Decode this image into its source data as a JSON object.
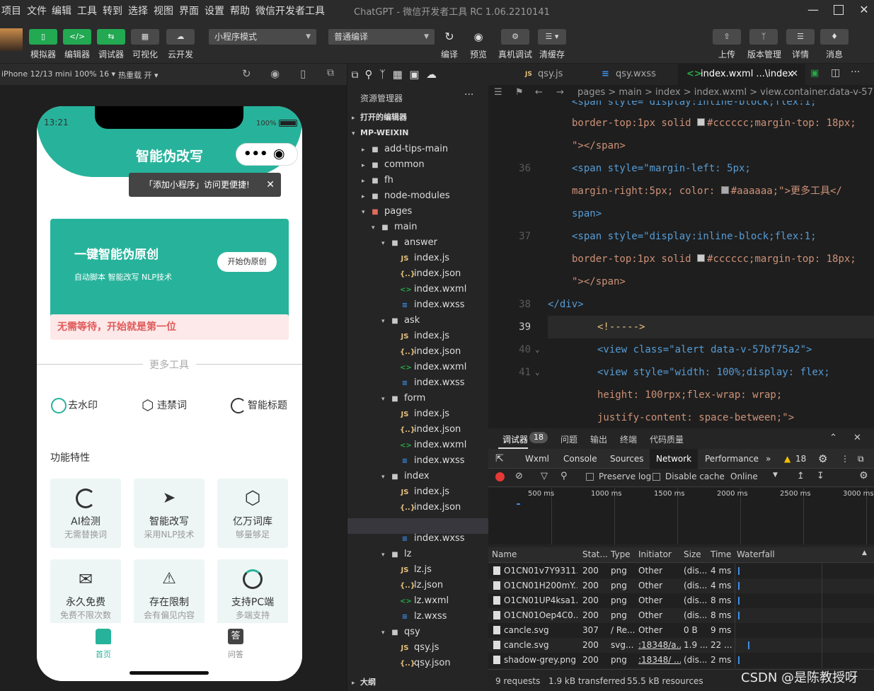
{
  "menubar": {
    "items": [
      "项目",
      "文件",
      "编辑",
      "工具",
      "转到",
      "选择",
      "视图",
      "界面",
      "设置",
      "帮助",
      "微信开发者工具"
    ],
    "window_title": "ChatGPT - 微信开发者工具 RC 1.06.2210141"
  },
  "toolbar": {
    "simulator": "模拟器",
    "editor": "编辑器",
    "debugger": "调试器",
    "visual": "可视化",
    "cloud": "云开发",
    "mode_select": "小程序模式",
    "compile_select": "普通编译",
    "compile": "编译",
    "preview": "预览",
    "real_debug": "真机调试",
    "clear_cache": "清缓存",
    "upload": "上传",
    "version": "版本管理",
    "details": "详情",
    "messages": "消息"
  },
  "devbar": {
    "device": "iPhone 12/13 mini 100% 16 ▾",
    "hotreload": "热重载 开 ▾"
  },
  "phone": {
    "time": "13:21",
    "battery": "100%",
    "title": "智能伪改写",
    "add_tip": "「添加小程序」访问更便捷!",
    "banner_title": "一键智能伪原创",
    "banner_sub": "自动脚本 智能改写 NLP技术",
    "banner_btn": "开始伪原创",
    "notice": "无需等待，开始就是第一位",
    "more_tools": "更多工具",
    "tools": [
      "去水印",
      "违禁词",
      "智能标题"
    ],
    "features_title": "功能特性",
    "features": [
      {
        "title": "AI检测",
        "sub": "无需替换词"
      },
      {
        "title": "智能改写",
        "sub": "采用NLP技术"
      },
      {
        "title": "亿万词库",
        "sub": "够量够足"
      },
      {
        "title": "永久免费",
        "sub": "免费不限次数"
      },
      {
        "title": "存在限制",
        "sub": "会有偏见内容"
      },
      {
        "title": "支持PC端",
        "sub": "多端支持"
      }
    ],
    "tab_home": "首页",
    "tab_qa": "问答"
  },
  "explorer": {
    "title": "资源管理器",
    "open_editors": "打开的编辑器",
    "project": "MP-WEIXIN",
    "outline": "大纲",
    "tree": [
      {
        "label": "add-tips-main",
        "kind": "folder"
      },
      {
        "label": "common",
        "kind": "folder"
      },
      {
        "label": "fh",
        "kind": "folder"
      },
      {
        "label": "node-modules",
        "kind": "folder"
      },
      {
        "label": "pages",
        "kind": "folder-open"
      },
      {
        "label": "main",
        "kind": "folder-open"
      },
      {
        "label": "answer",
        "kind": "folder-open"
      },
      {
        "label": "index.js",
        "kind": "js"
      },
      {
        "label": "index.json",
        "kind": "json"
      },
      {
        "label": "index.wxml",
        "kind": "wxml"
      },
      {
        "label": "index.wxss",
        "kind": "wxss"
      },
      {
        "label": "ask",
        "kind": "folder-open"
      },
      {
        "label": "index.js",
        "kind": "js"
      },
      {
        "label": "index.json",
        "kind": "json"
      },
      {
        "label": "index.wxml",
        "kind": "wxml"
      },
      {
        "label": "index.wxss",
        "kind": "wxss"
      },
      {
        "label": "form",
        "kind": "folder-open"
      },
      {
        "label": "index.js",
        "kind": "js"
      },
      {
        "label": "index.json",
        "kind": "json"
      },
      {
        "label": "index.wxml",
        "kind": "wxml"
      },
      {
        "label": "index.wxss",
        "kind": "wxss"
      },
      {
        "label": "index",
        "kind": "folder-open"
      },
      {
        "label": "index.js",
        "kind": "js"
      },
      {
        "label": "index.json",
        "kind": "json"
      },
      {
        "label": "index.wxml",
        "kind": "wxml"
      },
      {
        "label": "index.wxss",
        "kind": "wxss"
      },
      {
        "label": "lz",
        "kind": "folder-open"
      },
      {
        "label": "lz.js",
        "kind": "js"
      },
      {
        "label": "lz.json",
        "kind": "json"
      },
      {
        "label": "lz.wxml",
        "kind": "wxml"
      },
      {
        "label": "lz.wxss",
        "kind": "wxss"
      },
      {
        "label": "qsy",
        "kind": "folder-open"
      },
      {
        "label": "qsy.js",
        "kind": "js"
      },
      {
        "label": "qsy.json",
        "kind": "json"
      }
    ]
  },
  "editor": {
    "tabs": [
      "qsy.js",
      "qsy.wxss",
      "index.wxml ...\\index"
    ],
    "breadcrumb": "pages > main > index > index.wxml > view.container.data-v-57bf",
    "lines": {
      "l35b": "border-top:1px solid ",
      "l35b_col": "#cccccc;margin-top: 18px;",
      "l35c": "\"></span>",
      "l36a": "<span style=\"margin-left: 5px;",
      "l36b": "margin-right:5px; color: ",
      "l36b_col": "#aaaaaa;\">更多工具</",
      "l36c": "span>",
      "l37a": "<span style=\"display:inline-block;flex:1;",
      "l37b": "border-top:1px solid ",
      "l37b_col": "#cccccc;margin-top: 18px;",
      "l37c": "\"></span>",
      "l38": "</div>",
      "l39": "<!----->",
      "l40": "<view class=\"alert data-v-57bf75a2\">",
      "l41a": "<view style=\"width: 100%;display: flex;",
      "l41b": "height: 100rpx;flex-wrap: wrap;",
      "l41c": "justify-content: space-between;\">",
      "top": "<span style=\"display:inline-block;flex:1;"
    },
    "line_numbers": [
      "36",
      "37",
      "38",
      "39",
      "40",
      "41"
    ]
  },
  "devtools": {
    "tabs": [
      "调试器",
      "问题",
      "输出",
      "终端",
      "代码质量"
    ],
    "badge": "18",
    "panel_tabs": [
      "Wxml",
      "Console",
      "Sources",
      "Network",
      "Performance"
    ],
    "warn_count": "18",
    "preserve_log": "Preserve log",
    "disable_cache": "Disable cache",
    "online": "Online",
    "timeline_ticks": [
      "500 ms",
      "1000 ms",
      "1500 ms",
      "2000 ms",
      "2500 ms",
      "3000 ms"
    ],
    "columns": [
      "Name",
      "Stat...",
      "Type",
      "Initiator",
      "Size",
      "Time",
      "Waterfall"
    ],
    "rows": [
      [
        "O1CN01v7Y9311...",
        "200",
        "png",
        "Other",
        "(dis...",
        "4 ms"
      ],
      [
        "O1CN01H200mY...",
        "200",
        "png",
        "Other",
        "(dis...",
        "4 ms"
      ],
      [
        "O1CN01UP4ksa1...",
        "200",
        "png",
        "Other",
        "(dis...",
        "8 ms"
      ],
      [
        "O1CN01Oep4C0...",
        "200",
        "png",
        "Other",
        "(dis...",
        "8 ms"
      ],
      [
        "cancle.svg",
        "307",
        "/ Re...",
        "Other",
        "0 B",
        "9 ms"
      ],
      [
        "cancle.svg",
        "200",
        "svg...",
        ":18348/a...",
        "1.9 ...",
        "22 ..."
      ],
      [
        "shadow-grey.png",
        "200",
        "png",
        ":18348/ ...",
        "(dis...",
        "2 ms"
      ]
    ],
    "status": {
      "requests": "9 requests",
      "transferred": "1.9 kB transferred",
      "resources": "55.5 kB resources"
    }
  },
  "watermark": "CSDN @是陈教授呀",
  "colors": {
    "accent_green": "#22a952",
    "brand_teal": "#27b39b",
    "notice_red": "#e05a5a"
  }
}
